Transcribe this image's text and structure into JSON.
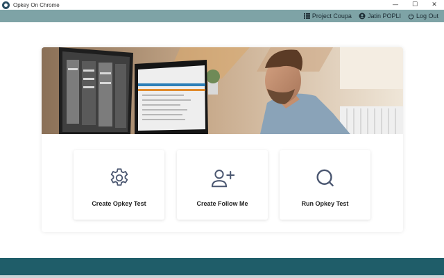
{
  "window": {
    "title": "Opkey On Chrome",
    "controls": {
      "minimize": "—",
      "maximize": "☐",
      "close": "✕"
    }
  },
  "header": {
    "project_label": "Project Coupa",
    "user_label": "Jatin POPLI",
    "logout_label": "Log Out",
    "icons": {
      "project": "list-icon",
      "user": "user-circle-icon",
      "logout": "power-icon"
    }
  },
  "tiles": [
    {
      "label": "Create Opkey Test",
      "icon": "gear-icon"
    },
    {
      "label": "Create Follow Me",
      "icon": "add-user-icon"
    },
    {
      "label": "Run Opkey Test",
      "icon": "search-icon"
    }
  ],
  "colors": {
    "header_bg": "#7ea3a6",
    "footer_bg": "#1f5d69",
    "icon_color": "#4a5670"
  }
}
